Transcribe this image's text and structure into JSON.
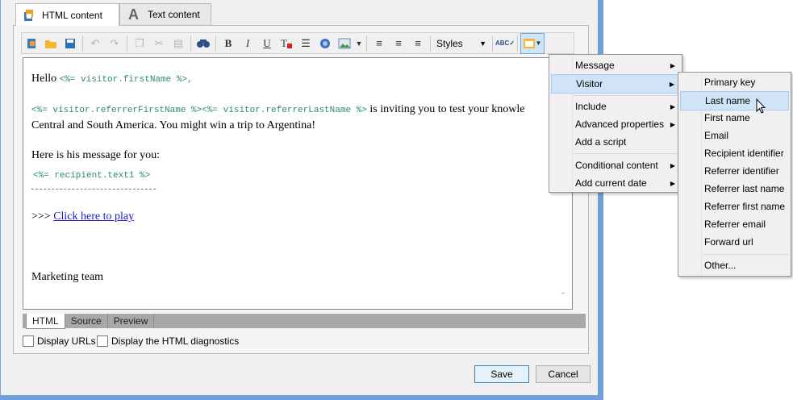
{
  "tabs": [
    {
      "label": "HTML content",
      "icon": "html-content-icon",
      "active": true
    },
    {
      "label": "Text content",
      "icon": "text-content-icon",
      "active": false
    }
  ],
  "toolbar": {
    "styles_label": "Styles"
  },
  "editor": {
    "hello": "Hello ",
    "firstname_tag": "<%= visitor.firstName %>,",
    "referrer_tags": "<%= visitor.referrerFirstName %><%= visitor.referrerLastName %>",
    "inviting_text": " is inviting you to test your knowle",
    "line3": "Central and South America. You might win a trip to Argentina!",
    "message_intro": "Here is his message for you:",
    "text1_tag": "<%= recipient.text1 %>",
    "prefix": ">>> ",
    "link_text": "Click here to play",
    "signature": "Marketing team"
  },
  "bottom_tabs": [
    "HTML",
    "Source",
    "Preview"
  ],
  "checkboxes": {
    "display_urls": "Display URLs",
    "display_diagnostics": "Display the HTML diagnostics"
  },
  "buttons": {
    "save": "Save",
    "cancel": "Cancel"
  },
  "menu": {
    "items": [
      "Message",
      "Visitor",
      "Include",
      "Advanced properties",
      "Add a script",
      "Conditional content",
      "Add current date"
    ]
  },
  "submenu": {
    "items": [
      "Primary key",
      "Last name",
      "First name",
      "Email",
      "Recipient identifier",
      "Referrer identifier",
      "Referrer last name",
      "Referrer first name",
      "Referrer email",
      "Forward url",
      "Other..."
    ]
  },
  "colors": {
    "accent": "#6f9fd8",
    "highlight": "#d1e4f7",
    "code": "#2a8a6c",
    "link": "#1a1acc"
  }
}
